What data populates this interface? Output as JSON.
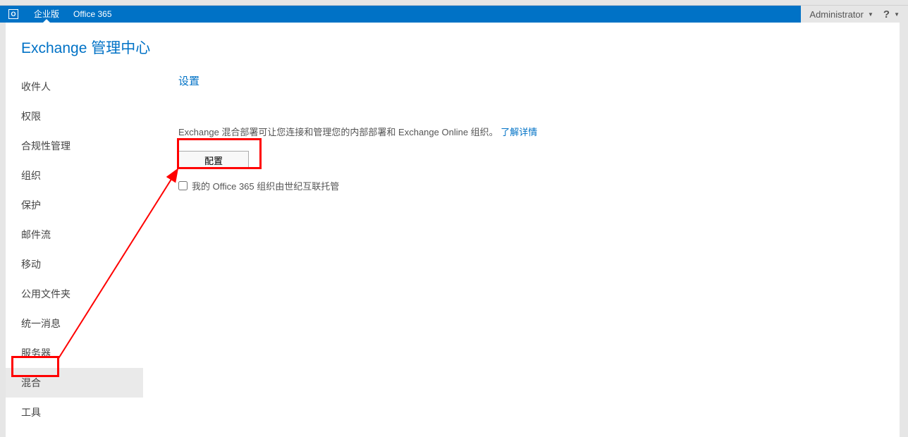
{
  "topbar": {
    "brand": "O",
    "tabs": [
      {
        "label": "企业版",
        "active": true
      },
      {
        "label": "Office 365",
        "active": false
      }
    ],
    "user": "Administrator",
    "help": "?"
  },
  "page_title": "Exchange 管理中心",
  "sidebar": {
    "items": [
      {
        "label": "收件人"
      },
      {
        "label": "权限"
      },
      {
        "label": "合规性管理"
      },
      {
        "label": "组织"
      },
      {
        "label": "保护"
      },
      {
        "label": "邮件流"
      },
      {
        "label": "移动"
      },
      {
        "label": "公用文件夹"
      },
      {
        "label": "统一消息"
      },
      {
        "label": "服务器"
      },
      {
        "label": "混合"
      },
      {
        "label": "工具"
      }
    ],
    "selected_index": 10
  },
  "panel": {
    "section_title": "设置",
    "description": "Exchange 混合部署可让您连接和管理您的内部部署和 Exchange Online 组织。",
    "learn_more": "了解详情",
    "config_button": "配置",
    "checkbox_label": "我的 Office 365 组织由世纪互联托管"
  }
}
